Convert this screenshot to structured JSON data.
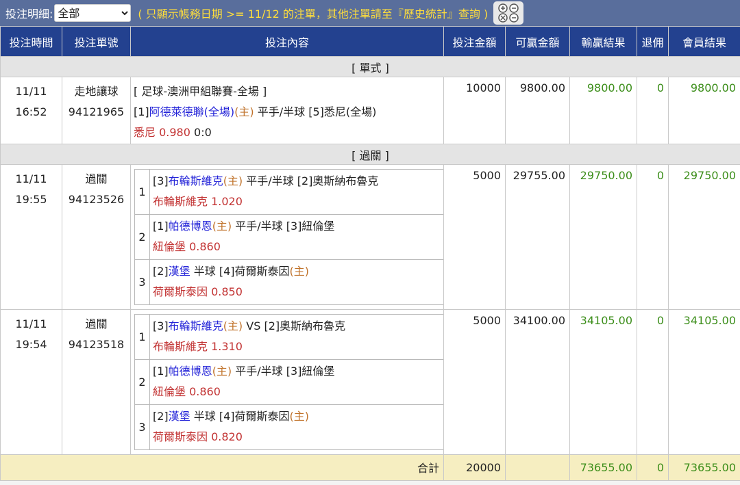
{
  "filter": {
    "label": "投注明細:",
    "selected": "全部",
    "note": "( 只顯示帳務日期 >= 11/12 的注單，其他注單請至『歷史統計』查詢 )"
  },
  "columns": [
    "投注時間",
    "投注單號",
    "投注內容",
    "投注金額",
    "可贏金額",
    "輸贏結果",
    "退佣",
    "會員結果"
  ],
  "sections": {
    "single": "[ 單式 ]",
    "parlay": "[ 過關 ]"
  },
  "single": {
    "date": "11/11",
    "time": "16:52",
    "type": "走地讓球",
    "id": "94121965",
    "league": "[ 足球-澳洲甲組聯賽-全場 ]",
    "home_idx": "[1]",
    "home": "阿德萊德聯(全場)",
    "home_tag": "(主)",
    "mid": " 平手/半球 ",
    "away": "[5]悉尼(全場)",
    "pick": "悉尼",
    "odds": "0.980",
    "score": " 0:0",
    "stake": "10000",
    "win": "9800.00",
    "result": "9800.00",
    "rebate": "0",
    "member": "9800.00"
  },
  "parlays": [
    {
      "date": "11/11",
      "time": "19:55",
      "type": "過關",
      "id": "94123526",
      "stake": "5000",
      "win": "29755.00",
      "result": "29750.00",
      "rebate": "0",
      "member": "29750.00",
      "legs": [
        {
          "n": "1",
          "idx": "[3]",
          "team": "布輪斯維克",
          "tag": "(主)",
          "mid": " 平手/半球 [2]奧斯納布魯克",
          "pick": "布輪斯維克 1.020"
        },
        {
          "n": "2",
          "idx": "[1]",
          "team": "帕德博恩",
          "tag": "(主)",
          "mid": " 平手/半球 [3]紐倫堡",
          "pick": "紐倫堡 0.860"
        },
        {
          "n": "3",
          "idx": "[2]",
          "team": "漢堡",
          "tag": "",
          "mid": " 半球 [4]荷爾斯泰因",
          "tag2": "(主)",
          "pick": "荷爾斯泰因 0.850"
        }
      ]
    },
    {
      "date": "11/11",
      "time": "19:54",
      "type": "過關",
      "id": "94123518",
      "stake": "5000",
      "win": "34100.00",
      "result": "34105.00",
      "rebate": "0",
      "member": "34105.00",
      "legs": [
        {
          "n": "1",
          "idx": "[3]",
          "team": "布輪斯維克",
          "tag": "(主)",
          "mid": " VS [2]奧斯納布魯克",
          "pick": "布輪斯維克 1.310"
        },
        {
          "n": "2",
          "idx": "[1]",
          "team": "帕德博恩",
          "tag": "(主)",
          "mid": " 平手/半球 [3]紐倫堡",
          "pick": "紐倫堡 0.860"
        },
        {
          "n": "3",
          "idx": "[2]",
          "team": "漢堡",
          "tag": "",
          "mid": " 半球 [4]荷爾斯泰因",
          "tag2": "(主)",
          "pick": "荷爾斯泰因 0.820"
        }
      ]
    }
  ],
  "total": {
    "label": "合計",
    "stake": "20000",
    "result": "73655.00",
    "rebate": "0",
    "member": "73655.00"
  },
  "colors": {
    "header": "#23418f",
    "topbar": "#596e9c",
    "note": "#ffde3b",
    "green": "#3c8e1a"
  }
}
